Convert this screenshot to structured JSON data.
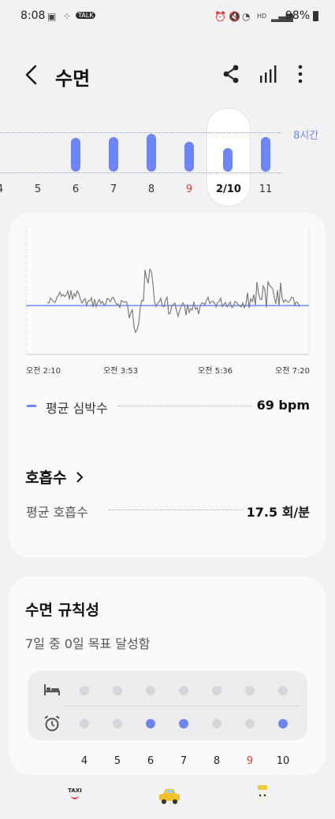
{
  "status_bar": {
    "time": "8:08",
    "battery": "98%",
    "network": "HD"
  },
  "header": {
    "title": "수면"
  },
  "week_strip": {
    "goal_label": "8시간",
    "days": [
      {
        "label": "4"
      },
      {
        "label": "5"
      },
      {
        "label": "6",
        "has_bar": true
      },
      {
        "label": "7",
        "has_bar": true
      },
      {
        "label": "8",
        "has_bar": true
      },
      {
        "label": "9",
        "has_bar": true,
        "color": "#d0443a"
      },
      {
        "label": "2/10",
        "has_bar": true,
        "selected": true
      },
      {
        "label": "11",
        "has_bar": true
      }
    ]
  },
  "heart_card": {
    "x_ticks": [
      "오전 2:10",
      "오전 3:53",
      "오전 5:36",
      "오전 7:20"
    ],
    "avg_label": "평균 심박수",
    "avg_value": "69 bpm"
  },
  "resp": {
    "title": "호흡수",
    "avg_label": "평균 호흡수",
    "avg_value": "17.5 회/분"
  },
  "regularity": {
    "title": "수면 규칙성",
    "subtitle": "7일 중 0일 목표 달성함",
    "days": [
      {
        "label": "4",
        "wake_on_target": false
      },
      {
        "label": "5",
        "wake_on_target": false
      },
      {
        "label": "6",
        "wake_on_target": true
      },
      {
        "label": "7",
        "wake_on_target": true
      },
      {
        "label": "8",
        "wake_on_target": false
      },
      {
        "label": "9",
        "wake_on_target": false,
        "color": "#d0443a"
      },
      {
        "label": "10",
        "wake_on_target": true
      }
    ]
  },
  "bottom_apps": {
    "taxi_label": "TAXI"
  },
  "colors": {
    "accent": "#6e86f5",
    "sunday": "#d0443a"
  }
}
